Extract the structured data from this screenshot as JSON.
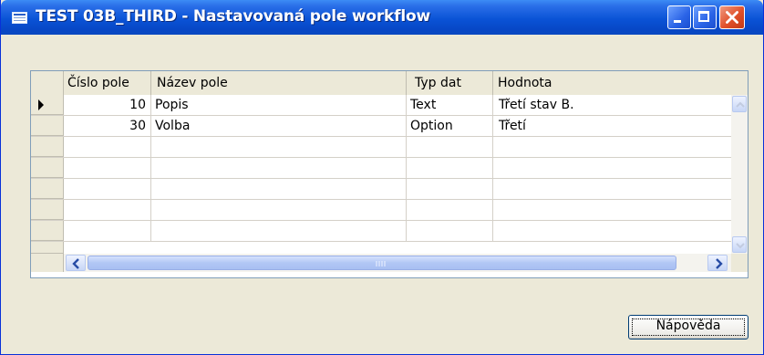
{
  "window": {
    "title": "TEST 03B_THIRD - Nastavovaná pole workflow"
  },
  "icons": {
    "title": "form-icon",
    "minimize": "minimize-icon",
    "maximize": "maximize-icon",
    "close": "close-icon",
    "current_row": "row-pointer-icon",
    "scroll_left": "arrow-left-icon",
    "scroll_right": "arrow-right-icon",
    "scroll_up": "arrow-up-icon",
    "scroll_down": "arrow-down-icon"
  },
  "grid": {
    "columns": [
      "Číslo pole",
      "Název pole",
      "Typ dat",
      "Hodnota"
    ],
    "rows": [
      {
        "cislo": "10",
        "nazev": "Popis",
        "typ": "Text",
        "hodnota": "Třetí stav B."
      },
      {
        "cislo": "30",
        "nazev": "Volba",
        "typ": "Option",
        "hodnota": "Třetí"
      }
    ]
  },
  "buttons": {
    "help": "Nápověda"
  },
  "colors": {
    "title_bar": "#0a53d6",
    "window_bg": "#ece9d8",
    "grid_border": "#7f9db9",
    "close_button": "#e0502a"
  }
}
